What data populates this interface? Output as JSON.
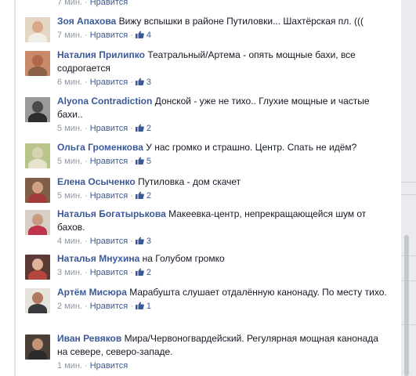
{
  "top_meta": {
    "time": "7 мин.",
    "like": "Нравится"
  },
  "comments": [
    {
      "author": "Зоя Апахова",
      "text": "Вижу вспышки в районе Путиловки... Шахтёрская пл. (((",
      "time": "7 мин.",
      "like": "Нравится",
      "likes": "4"
    },
    {
      "author": "Наталия Прилипко",
      "text": "Театральный/Артема - опять мощные бахи, все содрогается",
      "time": "6 мин.",
      "like": "Нравится",
      "likes": "3"
    },
    {
      "author": "Alyona Contradiction",
      "text": "Донской - уже не тихо.. Глухие мощные и частые бахи..",
      "time": "5 мин.",
      "like": "Нравится",
      "likes": "2"
    },
    {
      "author": "Ольга Громенкова",
      "text": "У нас громко и страшно. Центр. Спать не идём?",
      "time": "5 мин.",
      "like": "Нравится",
      "likes": "5"
    },
    {
      "author": "Елена Осыченко",
      "text": "Путиловка - дом скачет",
      "time": "5 мин.",
      "like": "Нравится",
      "likes": "2"
    },
    {
      "author": "Наталья Богатырькова",
      "text": "Макеевка-центр, непрекращающейся шум от бахов.",
      "time": "4 мин.",
      "like": "Нравится",
      "likes": "3"
    },
    {
      "author": "Наталья Мнухина",
      "text": "на Голубом громко",
      "time": "3 мин.",
      "like": "Нравится",
      "likes": "2"
    },
    {
      "author": "Артём Мисюра",
      "text": "Марабушта слушает отдалённую канонаду. По месту тихо.",
      "time": "2 мин.",
      "like": "Нравится",
      "likes": "1"
    },
    {
      "author": "Иван Ревяков",
      "text": "Мира/Червоногвардейский. Регулярная мощная канонада на севере, северо-западе.",
      "time": "1 мин.",
      "like": "Нравится",
      "likes": ""
    }
  ],
  "colors": {
    "link": "#3b5998",
    "meta": "#9197a3",
    "text": "#141823"
  },
  "icons": {
    "like": "thumbs-up-icon"
  }
}
